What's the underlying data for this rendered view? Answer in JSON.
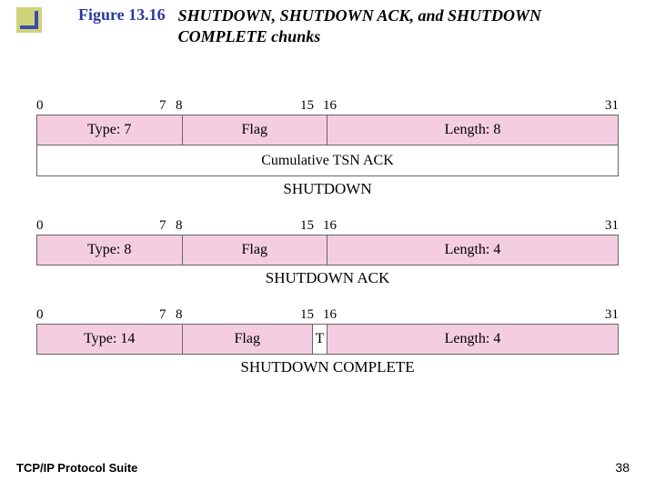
{
  "figure_label": "Figure 13.16",
  "figure_title": "SHUTDOWN, SHUTDOWN ACK, and SHUTDOWN COMPLETE chunks",
  "footer_left": "TCP/IP Protocol Suite",
  "footer_right": "38",
  "bit_markers": {
    "b0": "0",
    "b7": "7",
    "b8": "8",
    "b15": "15",
    "b16": "16",
    "b31": "31"
  },
  "chunks": [
    {
      "rows": [
        {
          "cells": [
            "Type: 7",
            "Flag",
            "Length: 8"
          ],
          "bg": "pink"
        },
        {
          "cells": [
            "Cumulative TSN ACK"
          ],
          "bg": "white"
        }
      ],
      "caption": "SHUTDOWN"
    },
    {
      "rows": [
        {
          "cells": [
            "Type: 8",
            "Flag",
            "Length: 4"
          ],
          "bg": "pink"
        }
      ],
      "caption": "SHUTDOWN ACK"
    },
    {
      "rows": [
        {
          "cells": [
            "Type: 14",
            "Flag",
            "T",
            "Length: 4"
          ],
          "bg": "pink",
          "has_t": true
        }
      ],
      "caption": "SHUTDOWN COMPLETE"
    }
  ],
  "chart_data": {
    "type": "table",
    "title": "SCTP SHUTDOWN-related chunk header formats (32-bit words)",
    "bit_ruler": [
      0,
      7,
      8,
      15,
      16,
      31
    ],
    "chunks": [
      {
        "name": "SHUTDOWN",
        "fields": [
          {
            "name": "Type",
            "bits": "0-7",
            "value": 7
          },
          {
            "name": "Flag",
            "bits": "8-15"
          },
          {
            "name": "Length",
            "bits": "16-31",
            "value": 8
          },
          {
            "name": "Cumulative TSN ACK",
            "bits": "0-31"
          }
        ]
      },
      {
        "name": "SHUTDOWN ACK",
        "fields": [
          {
            "name": "Type",
            "bits": "0-7",
            "value": 8
          },
          {
            "name": "Flag",
            "bits": "8-15"
          },
          {
            "name": "Length",
            "bits": "16-31",
            "value": 4
          }
        ]
      },
      {
        "name": "SHUTDOWN COMPLETE",
        "fields": [
          {
            "name": "Type",
            "bits": "0-7",
            "value": 14
          },
          {
            "name": "Flag",
            "bits": "8-14"
          },
          {
            "name": "T",
            "bits": "15"
          },
          {
            "name": "Length",
            "bits": "16-31",
            "value": 4
          }
        ]
      }
    ]
  }
}
